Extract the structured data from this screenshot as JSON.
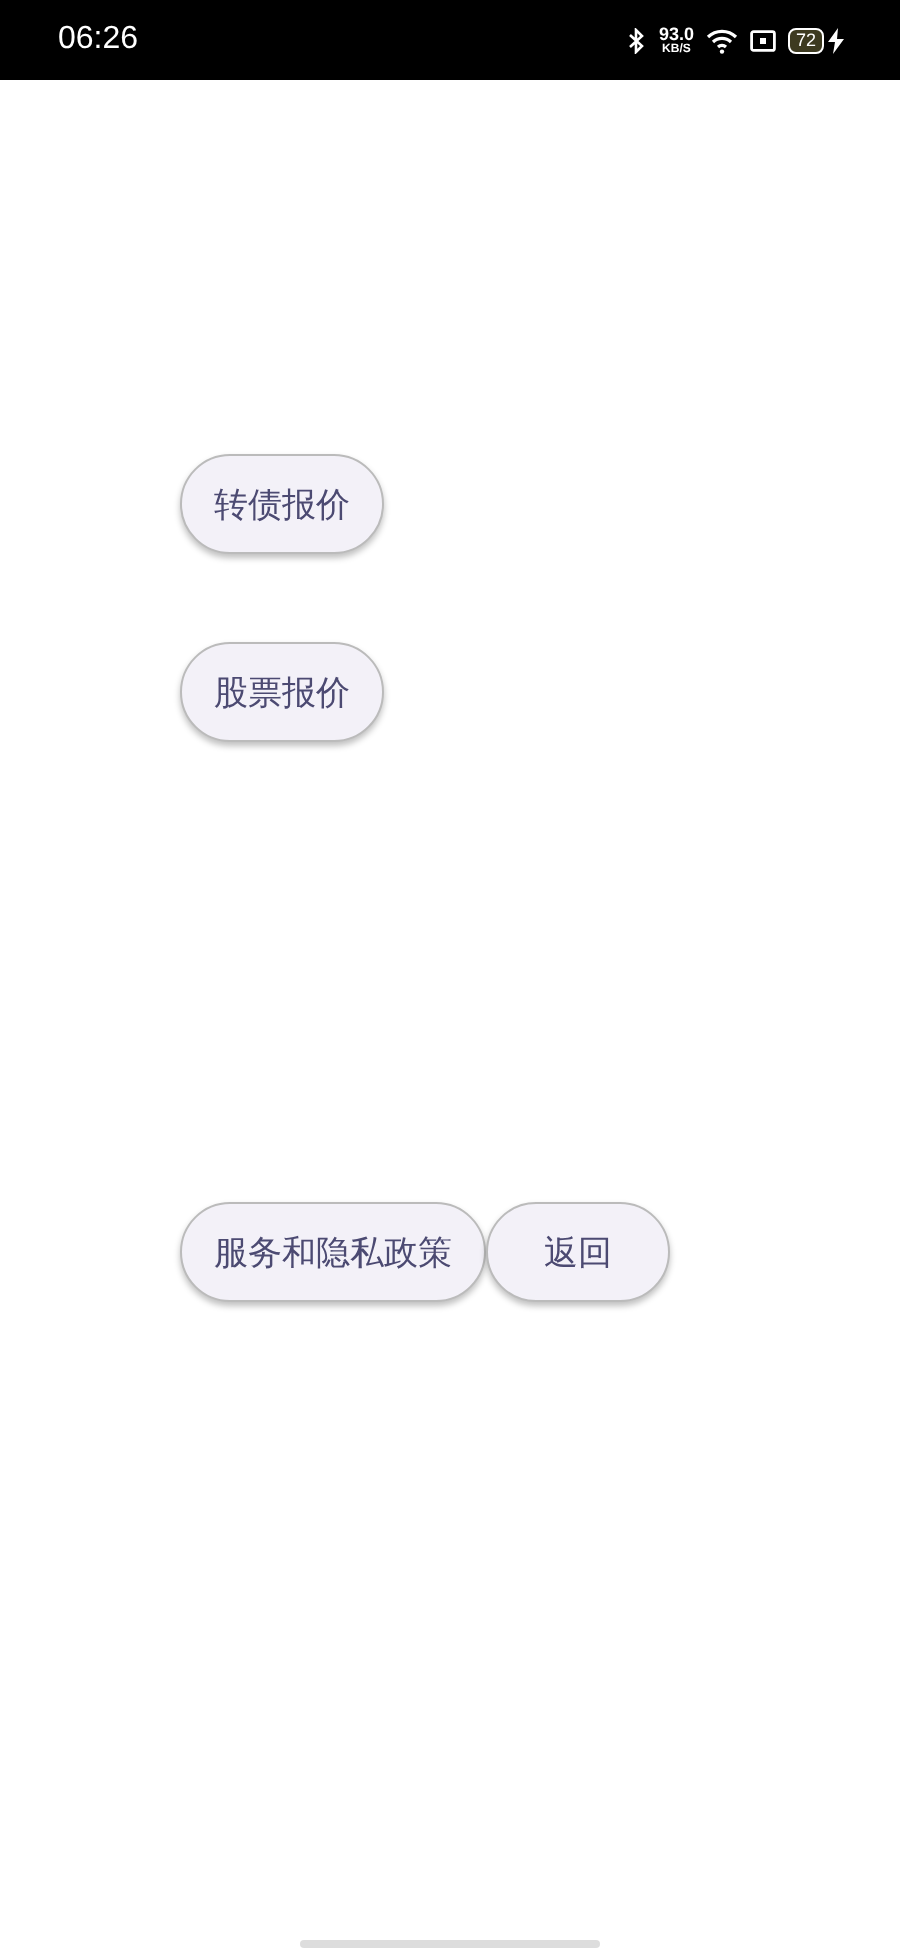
{
  "status_bar": {
    "time": "06:26",
    "net_speed": "93.0",
    "net_unit": "KB/S",
    "battery": "72"
  },
  "quote_buttons": [
    "转债报价",
    "股票报价"
  ],
  "footer_buttons": [
    "服务和隐私政策",
    "返回"
  ]
}
